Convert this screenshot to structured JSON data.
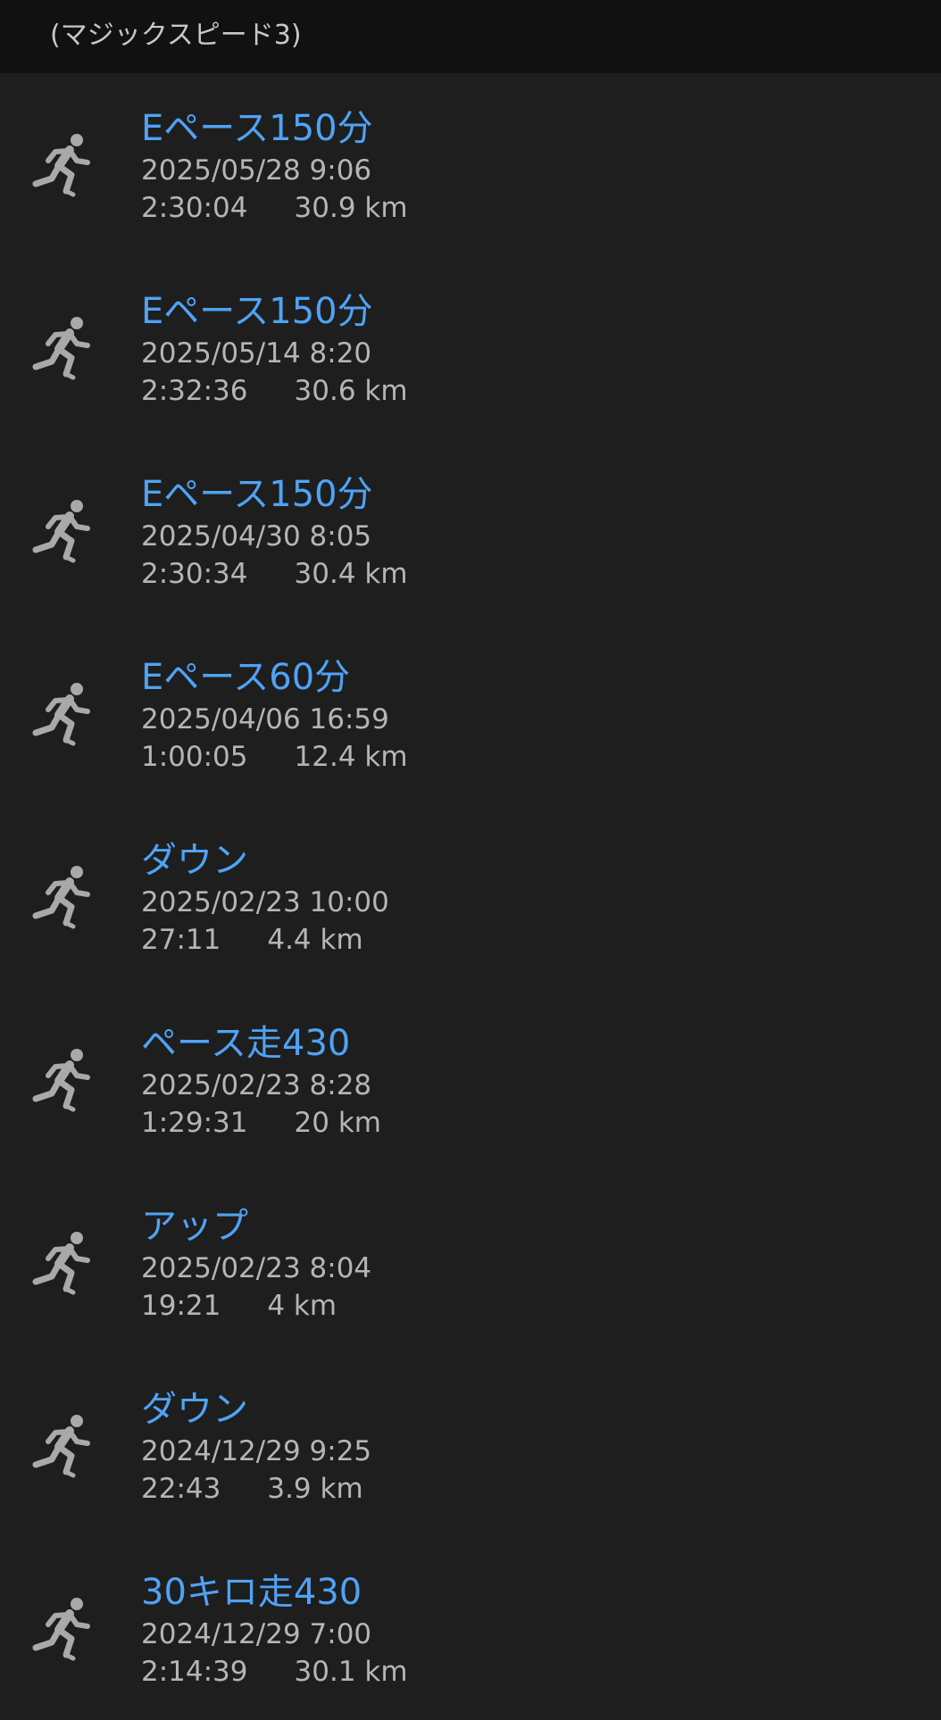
{
  "header": {
    "title": "(マジックスピード3)"
  },
  "icon": "running-person-icon",
  "colors": {
    "background": "#1e1e1e",
    "header": "#111111",
    "title": "#4fa3f5",
    "meta": "#b5b5b5"
  },
  "activities": [
    {
      "title": "Eペース150分",
      "date": "2025/05/28 9:06",
      "duration": "2:30:04",
      "distance": "30.9 km"
    },
    {
      "title": "Eペース150分",
      "date": "2025/05/14 8:20",
      "duration": "2:32:36",
      "distance": "30.6 km"
    },
    {
      "title": "Eペース150分",
      "date": "2025/04/30 8:05",
      "duration": "2:30:34",
      "distance": "30.4 km"
    },
    {
      "title": "Eペース60分",
      "date": "2025/04/06 16:59",
      "duration": "1:00:05",
      "distance": "12.4 km"
    },
    {
      "title": "ダウン",
      "date": "2025/02/23 10:00",
      "duration": "27:11",
      "distance": "4.4 km"
    },
    {
      "title": "ペース走430",
      "date": "2025/02/23 8:28",
      "duration": "1:29:31",
      "distance": "20 km"
    },
    {
      "title": "アップ",
      "date": "2025/02/23 8:04",
      "duration": "19:21",
      "distance": "4 km"
    },
    {
      "title": "ダウン",
      "date": "2024/12/29 9:25",
      "duration": "22:43",
      "distance": "3.9 km"
    },
    {
      "title": "30キロ走430",
      "date": "2024/12/29 7:00",
      "duration": "2:14:39",
      "distance": "30.1 km"
    }
  ]
}
